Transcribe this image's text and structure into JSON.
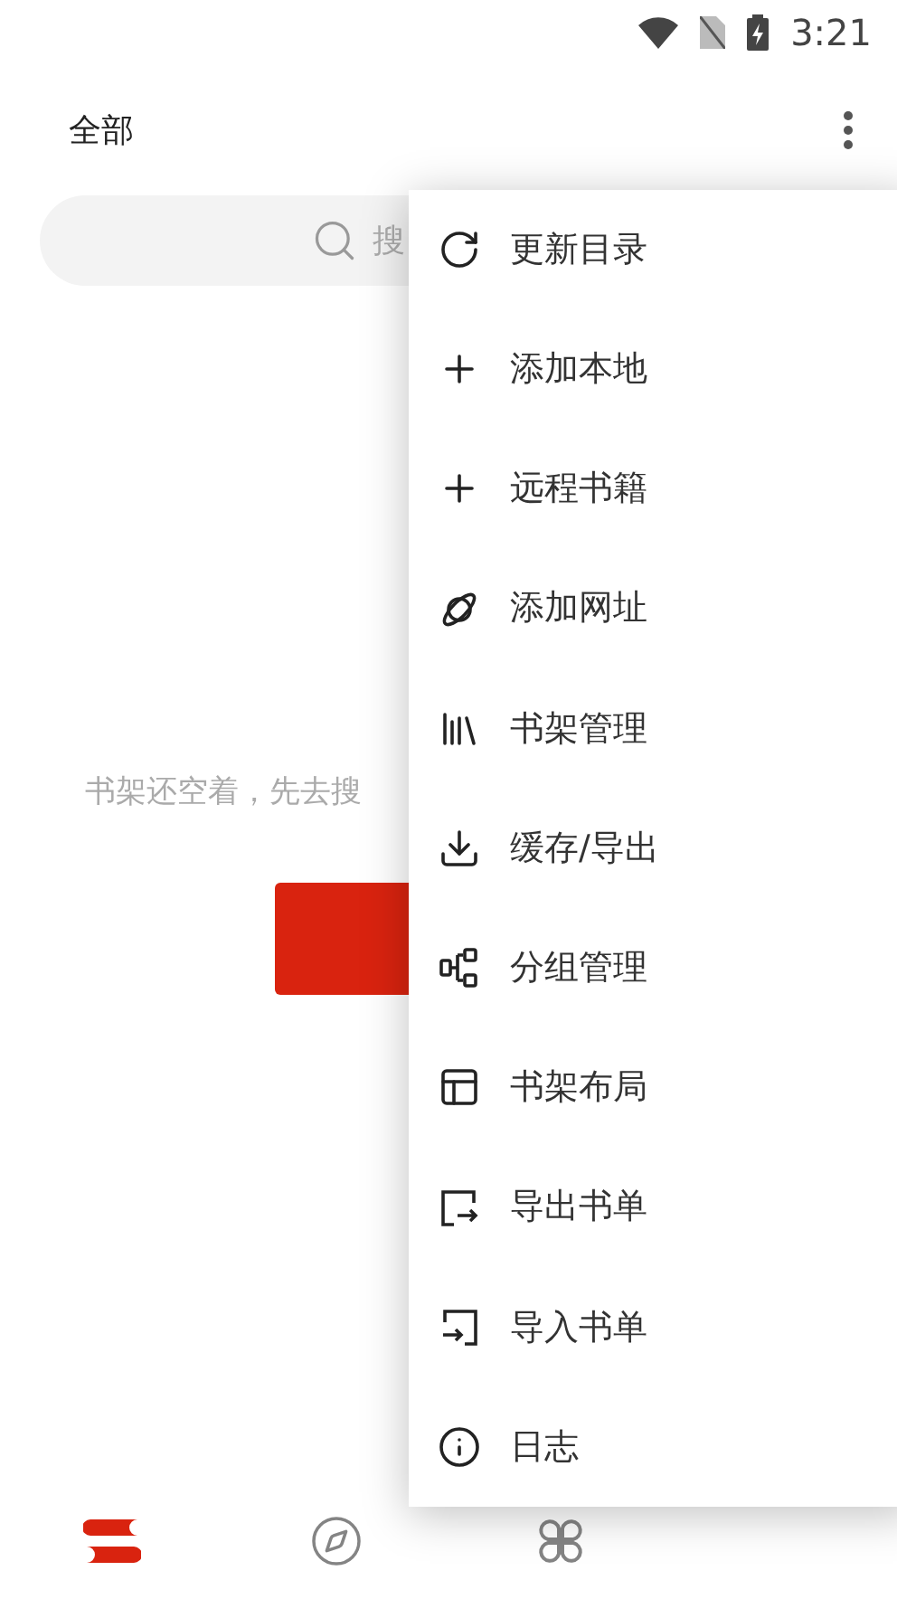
{
  "status_bar": {
    "time": "3:21"
  },
  "header": {
    "title": "全部"
  },
  "search": {
    "placeholder": "搜"
  },
  "empty_message": "书架还空着，先去搜",
  "menu": {
    "items": [
      {
        "kind": "refresh",
        "label": "更新目录"
      },
      {
        "kind": "add",
        "label": "添加本地"
      },
      {
        "kind": "add",
        "label": "远程书籍"
      },
      {
        "kind": "planet",
        "label": "添加网址"
      },
      {
        "kind": "books",
        "label": "书架管理"
      },
      {
        "kind": "download",
        "label": "缓存/导出"
      },
      {
        "kind": "group",
        "label": "分组管理"
      },
      {
        "kind": "layout",
        "label": "书架布局"
      },
      {
        "kind": "export",
        "label": "导出书单"
      },
      {
        "kind": "import",
        "label": "导入书单"
      },
      {
        "kind": "info",
        "label": "日志"
      }
    ]
  },
  "bottom_nav": [
    {
      "kind": "bookshelf",
      "selected": true
    },
    {
      "kind": "explore",
      "selected": false
    },
    {
      "kind": "apps",
      "selected": false
    }
  ]
}
